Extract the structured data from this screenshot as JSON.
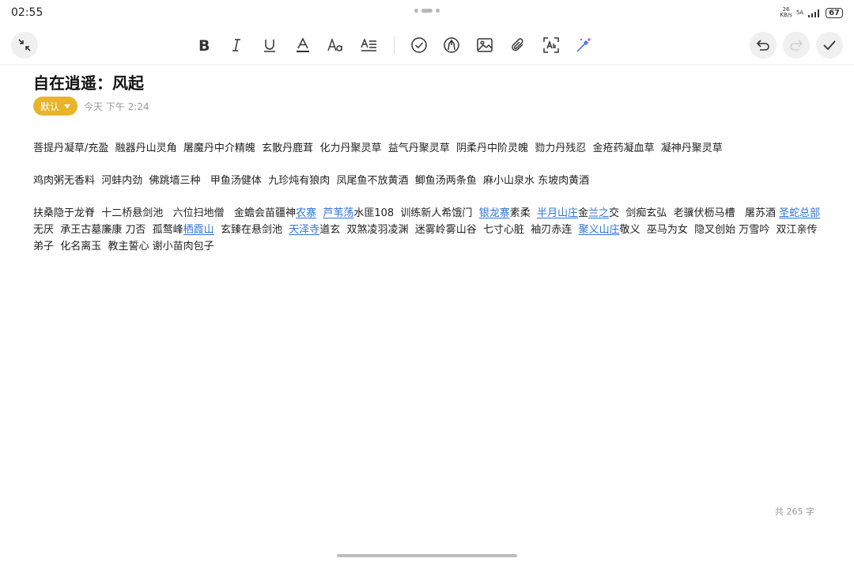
{
  "status_bar": {
    "time": "02:55",
    "net_top": "26",
    "net_bottom": "KB/s",
    "sim": "5A",
    "battery": "67"
  },
  "toolbar": {
    "collapse": "collapse-icon",
    "tools": [
      "bold-icon",
      "italic-icon",
      "underline-icon",
      "text-color-icon",
      "font-size-icon",
      "paragraph-format-icon",
      "checklist-icon",
      "pen-icon",
      "image-icon",
      "attachment-icon",
      "scan-text-icon",
      "ai-magic-icon"
    ],
    "undo": "undo-icon",
    "redo": "redo-icon",
    "done": "check-icon"
  },
  "note": {
    "title": "自在逍遥：风起",
    "category": "默认",
    "timestamp": "今天 下午 2:24",
    "paragraphs": [
      [
        {
          "t": "菩提丹凝草/充盈  融器丹山灵角  屠魔丹中介精魄  玄散丹鹿茸  化力丹聚灵草  益气丹聚灵草  阴柔丹中阶灵魄  勠力丹残忍  金疮药凝血草  凝神丹聚灵草"
        }
      ],
      [
        {
          "t": "鸡肉粥无香料  河蚌内劲  佛跳墙三种   甲鱼汤健体  九珍炖有狼肉  凤尾鱼不放黄酒  鲫鱼汤两条鱼  麻小山泉水 东坡肉黄酒"
        }
      ],
      [
        {
          "t": "扶桑隐于龙脊  十二桥悬剑池   六位扫地僧   金蟾会苗疆神"
        },
        {
          "t": "农寨",
          "link": true
        },
        {
          "t": "  "
        },
        {
          "t": "芦苇荡",
          "link": true
        },
        {
          "t": "水匪108  训练新人希饿门  "
        },
        {
          "t": "银龙寨",
          "link": true
        },
        {
          "t": "素柔  "
        },
        {
          "t": "半月山庄",
          "link": true
        },
        {
          "t": "金"
        },
        {
          "t": "兰之",
          "link": true
        },
        {
          "t": "交  剑痴玄弘  老骥伏枥马槽   屠苏酒 "
        },
        {
          "t": "圣蛇总部",
          "link": true
        },
        {
          "t": "无厌  承王古墓廉康 刀否  孤鹜峰"
        },
        {
          "t": "栖霞山",
          "link": true
        },
        {
          "t": "  玄臻在悬剑池  "
        },
        {
          "t": "天泽寺",
          "link": true
        },
        {
          "t": "道玄  双煞凌羽凌渊  迷雾岭雾山谷  七寸心脏  袖刃赤连  "
        },
        {
          "t": "聚义山庄",
          "link": true
        },
        {
          "t": "敬义  巫马为女  隐叉创始 万雪吟  双江亲传弟子  化名离玉  教主誓心 谢小苗肉包子"
        }
      ]
    ],
    "word_count": "共 265 字"
  }
}
